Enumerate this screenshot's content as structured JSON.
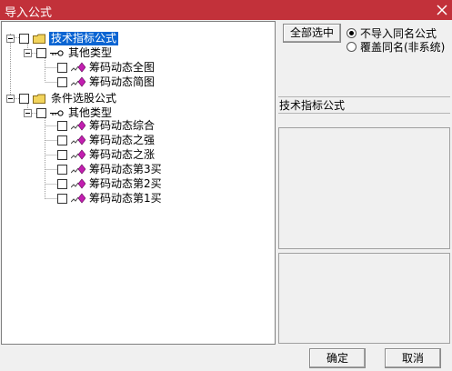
{
  "window": {
    "title": "导入公式"
  },
  "tree": [
    {
      "label": "技术指标公式",
      "selected": true
    },
    {
      "label": "其他类型"
    },
    {
      "label": "筹码动态全图"
    },
    {
      "label": "筹码动态简图"
    },
    {
      "label": "条件选股公式"
    },
    {
      "label": "其他类型"
    },
    {
      "label": "筹码动态综合"
    },
    {
      "label": "筹码动态之强"
    },
    {
      "label": "筹码动态之涨"
    },
    {
      "label": "筹码动态第3买"
    },
    {
      "label": "筹码动态第2买"
    },
    {
      "label": "筹码动态第1买"
    }
  ],
  "options": {
    "select_all_label": "全部选中",
    "radio_skip_label": "不导入同名公式",
    "radio_overwrite_label": "覆盖同名(非系统)",
    "selected": "skip"
  },
  "info": {
    "heading": "技术指标公式"
  },
  "footer": {
    "ok_label": "确定",
    "cancel_label": "取消"
  },
  "colors": {
    "titlebar": "#c2313a",
    "selection": "#0a64d2",
    "folder": "#f2d45c",
    "formula_icon": "#c21fb0"
  }
}
